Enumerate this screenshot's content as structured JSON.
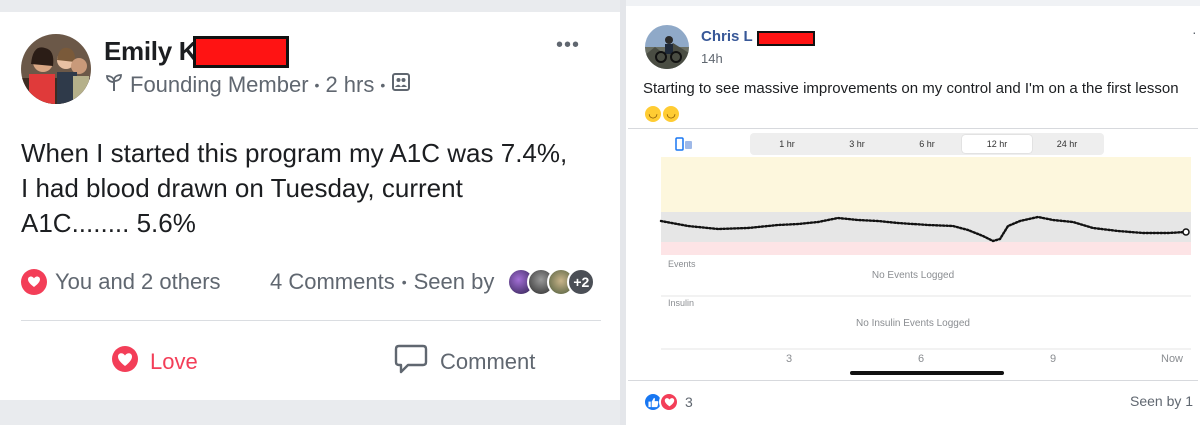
{
  "left_post": {
    "author_name": "Emily K",
    "badge_label": "Founding Member",
    "timestamp": "2 hrs",
    "more_label": "•••",
    "body_lines": [
      "When I started this program my A1C was 7.4%,",
      "I had blood drawn on Tuesday, current",
      "A1C........ 5.6%"
    ],
    "reactions_text": "You and 2 others",
    "comments_text": "4 Comments",
    "seen_by_label": "Seen by",
    "seen_more": "+2",
    "love_label": "Love",
    "comment_label": "Comment",
    "colors": {
      "love": "#f33e58",
      "secondary_text": "#606770"
    },
    "icons": [
      "sprout-icon",
      "audience-group-icon",
      "heart-icon",
      "speech-bubble-icon"
    ]
  },
  "right_post": {
    "author_name": "Chris L",
    "timestamp": "14h",
    "body_text": "Starting to see massive improvements on my control and I'm on a the first lesson",
    "emoji_count": 2,
    "cgm_widget": {
      "range_tabs": [
        "1 hr",
        "3 hr",
        "6 hr",
        "12 hr",
        "24 hr"
      ],
      "active_tab": "12 hr",
      "events_label": "Events",
      "events_empty": "No Events Logged",
      "insulin_label": "Insulin",
      "insulin_empty": "No Insulin Events Logged",
      "x_ticks": [
        "3",
        "6",
        "9",
        "Now"
      ]
    },
    "reaction_count": "3",
    "seen_by": "Seen by 1",
    "colors": {
      "name_link": "#385898",
      "like": "#1877f2",
      "love": "#f33e58",
      "high_band": "#fdf7dd",
      "target_band": "#e6e6e6",
      "low_band": "#fde4e6"
    },
    "icons": [
      "like-thumb-icon",
      "heart-icon",
      "phone-sync-icon"
    ]
  }
}
